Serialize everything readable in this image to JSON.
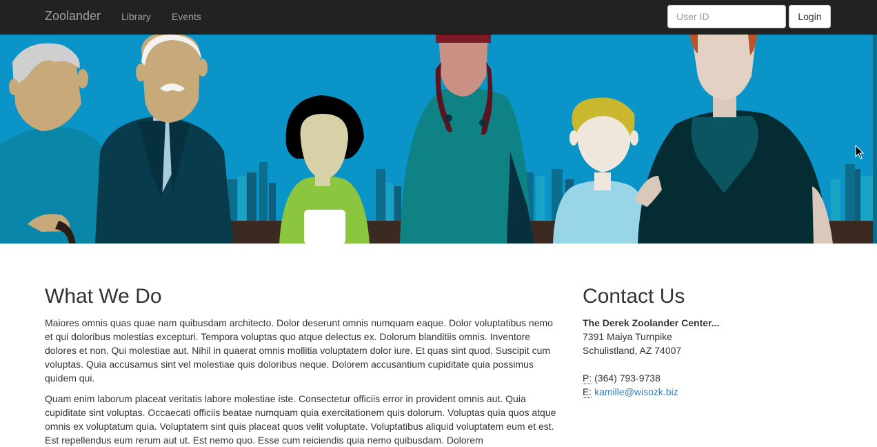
{
  "navbar": {
    "brand": "Zoolander",
    "links": [
      "Library",
      "Events"
    ],
    "user_id_placeholder": "User ID",
    "login_label": "Login"
  },
  "main": {
    "title": "What We Do",
    "paragraphs": [
      "Maiores omnis quas quae nam quibusdam architecto. Dolor deserunt omnis numquam eaque. Dolor voluptatibus nemo et qui doloribus molestias excepturi. Tempora voluptas quo atque delectus ex. Dolorum blanditiis omnis. Inventore dolores et non. Qui molestiae aut. Nihil in quaerat omnis mollitia voluptatem dolor iure. Et quas sint quod. Suscipit cum voluptas. Quia accusamus sint vel molestiae quis doloribus neque. Dolorem accusantium cupiditate quia possimus quidem qui.",
      "Quam enim laborum placeat veritatis labore molestiae iste. Consectetur officiis error in provident omnis aut. Quia cupiditate sint voluptas. Occaecati officiis beatae numquam quia exercitationem quis dolorum. Voluptas quia quos atque omnis ex voluptatum quia. Voluptatem sint quis placeat quos velit voluptate. Voluptatibus aliquid voluptatem eum et est. Est repellendus eum rerum aut ut. Est nemo quo. Esse cum reiciendis quia nemo quibusdam. Dolorem"
    ]
  },
  "contact": {
    "title": "Contact Us",
    "name": "The Derek Zoolander Center...",
    "street": "7391 Maiya Turnpike",
    "city": "Schulistland, AZ 74007",
    "phone_label": "P:",
    "phone": "(364) 793-9738",
    "email_label": "E:",
    "email": "kamille@wisozk.biz"
  },
  "colors": {
    "navbar_bg": "#222222",
    "hero_bg": "#0a94c8",
    "link": "#337ab7"
  }
}
